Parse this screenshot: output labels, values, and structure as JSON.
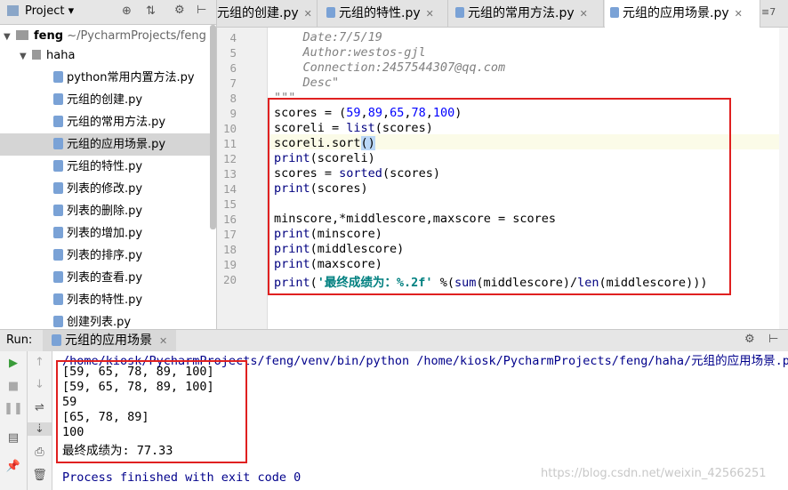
{
  "project": {
    "title": "Project",
    "root_label": "feng",
    "root_path": "~/PycharmProjects/feng",
    "folder": "haha",
    "files": [
      "python常用内置方法.py",
      "元组的创建.py",
      "元组的常用方法.py",
      "元组的应用场景.py",
      "元组的特性.py",
      "列表的修改.py",
      "列表的删除.py",
      "列表的增加.py",
      "列表的排序.py",
      "列表的查看.py",
      "列表的特性.py",
      "创建列表.py"
    ],
    "selected_file": "元组的应用场景.py"
  },
  "tabs": [
    {
      "label": "元组的创建.py"
    },
    {
      "label": "元组的特性.py"
    },
    {
      "label": "元组的常用方法.py"
    },
    {
      "label": "元组的应用场景.py",
      "active": true
    }
  ],
  "tab_overflow": "≡7",
  "editor": {
    "line_numbers": [
      "4",
      "5",
      "6",
      "7",
      "8",
      "9",
      "10",
      "11",
      "12",
      "13",
      "14",
      "15",
      "16",
      "17",
      "18",
      "19",
      "20"
    ],
    "lines": {
      "l4": "    Date:7/5/19",
      "l5": "    Author:westos-gjl",
      "l6": "    Connection:2457544307@qq.com",
      "l7": "    Desc\"",
      "l8": "\"\"\"",
      "l9_a": "scores = (",
      "l9_b": "59",
      "l9_c": ",",
      "l9_d": "89",
      "l9_e": ",",
      "l9_f": "65",
      "l9_g": ",",
      "l9_h": "78",
      "l9_i": ",",
      "l9_j": "100",
      "l9_k": ")",
      "l10_a": "scoreli = ",
      "l10_b": "list",
      "l10_c": "(scores)",
      "l11_a": "scoreli.sort",
      "l11_b": "()",
      "l12_a": "print",
      "l12_b": "(scoreli)",
      "l13_a": "scores = ",
      "l13_b": "sorted",
      "l13_c": "(scores)",
      "l14_a": "print",
      "l14_b": "(scores)",
      "l16": "minscore,*middlescore,maxscore = scores",
      "l17_a": "print",
      "l17_b": "(minscore)",
      "l18_a": "print",
      "l18_b": "(middlescore)",
      "l19_a": "print",
      "l19_b": "(maxscore)",
      "l20_a": "print",
      "l20_b": "(",
      "l20_c": "'最终成绩为：%.2f'",
      "l20_d": " %(",
      "l20_e": "sum",
      "l20_f": "(middlescore)/",
      "l20_g": "len",
      "l20_h": "(middlescore)))"
    }
  },
  "run": {
    "label": "Run:",
    "tab": "元组的应用场景",
    "command": "/home/kiosk/PycharmProjects/feng/venv/bin/python /home/kiosk/PycharmProjects/feng/haha/元组的应用场景.py",
    "output": [
      "[59, 65, 78, 89, 100]",
      "[59, 65, 78, 89, 100]",
      "59",
      "[65, 78, 89]",
      "100",
      "最终成绩为: 77.33"
    ],
    "exit": "Process finished with exit code 0"
  },
  "watermark": "https://blog.csdn.net/weixin_42566251",
  "colors": {
    "highlight_box": "#e02020",
    "keyword": "#000080",
    "number": "#0000ff",
    "string": "#008080"
  }
}
